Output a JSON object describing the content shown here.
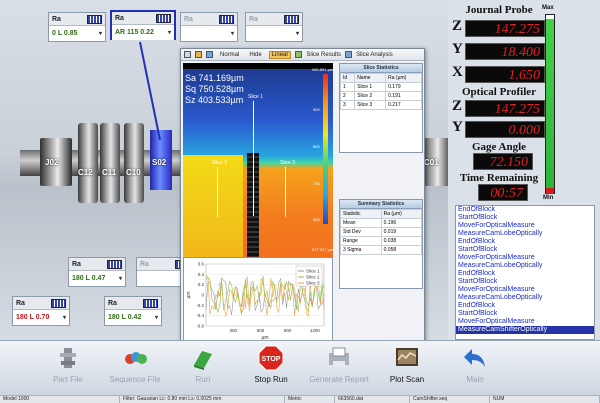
{
  "background_part": {
    "labels": [
      "J02",
      "C12",
      "C11",
      "C10",
      "S02",
      "C01"
    ]
  },
  "ra_widgets": [
    {
      "title": "Ra",
      "value": "0 L  0.85",
      "state": "active"
    },
    {
      "title": "Ra",
      "value": "AR  115  0.22",
      "state": "selected"
    },
    {
      "title": "Ra",
      "value": "",
      "state": "dim"
    },
    {
      "title": "Ra",
      "value": "",
      "state": "dim"
    },
    {
      "title": "Ra",
      "value": "180 L  0.47",
      "state": "active"
    },
    {
      "title": "Ra",
      "value": "",
      "state": "dim"
    },
    {
      "title": "Ra",
      "value": "180 L  0.70",
      "state": "active-red"
    },
    {
      "title": "Ra",
      "value": "180 L  0.42",
      "state": "active"
    },
    {
      "title": "Ra",
      "value": "",
      "state": "dim"
    }
  ],
  "popup": {
    "toolbar": {
      "normal": "Normal",
      "hide": "Hide",
      "linear": "Linear",
      "slice_results": "Slice Results",
      "slice_analysis": "Slice Analysis"
    },
    "surface": {
      "sa": "Sa 741.169µm",
      "sq": "Sq 750.528µm",
      "sz": "Sz 403.533µm",
      "cb_max": "980.851 µm",
      "cb_min": "577.317 µm",
      "cb_ticks": [
        "900",
        "800",
        "700",
        "600"
      ],
      "slices": [
        "Slice 1",
        "Slice 2",
        "Slice 3"
      ]
    },
    "slice_stats": {
      "title": "Slice Statistics",
      "headers": [
        "Id",
        "Name",
        "Ra (µm)"
      ],
      "rows": [
        [
          "1",
          "Slice 1",
          "0.179"
        ],
        [
          "2",
          "Slice 2",
          "0.191"
        ],
        [
          "3",
          "Slice 3",
          "0.217"
        ]
      ]
    },
    "summary_stats": {
      "title": "Summary Statistics",
      "headers": [
        "Statistic",
        "Ra (µm)"
      ],
      "rows": [
        [
          "Mean",
          "0.196"
        ],
        [
          "Std Dev",
          "0.019"
        ],
        [
          "Range",
          "0.038"
        ],
        [
          "3 Sigma",
          "0.058"
        ]
      ]
    }
  },
  "chart_data": {
    "type": "line",
    "xlabel": "µm",
    "ylabel": "µm",
    "x_ticks": [
      "300",
      "600",
      "900",
      "1200"
    ],
    "y_ticks": [
      "0.6",
      "0.4",
      "0.2",
      "0",
      "-0.2",
      "-0.4",
      "-0.6"
    ],
    "xlim": [
      0,
      1300
    ],
    "ylim": [
      -0.6,
      0.6
    ],
    "legend": "top-right",
    "series": [
      {
        "name": "Slice 1",
        "color": "#9a9a9a"
      },
      {
        "name": "Slice 2",
        "color": "#8cc63f"
      },
      {
        "name": "Slice 3",
        "color": "#f0a63c"
      }
    ]
  },
  "right_panel": {
    "journal_probe": "Journal Probe",
    "max_label": "Max",
    "min_label": "Min",
    "z1": "Z",
    "z1_val": "147.275",
    "y1": "Y",
    "y1_val": "18.400",
    "x1": "X",
    "x1_val": "1.650",
    "optical_profiler": "Optical Profiler",
    "z2": "Z",
    "z2_val": "147.275",
    "y2": "Y",
    "y2_val": "0.000",
    "gage_angle": "Gage Angle",
    "gage_val": "72.150",
    "time_remaining": "Time Remaining",
    "time_val": "00:57",
    "gauge_level": 0.97,
    "colors": {
      "lcd_text": "#e52020",
      "gauge": "#3fc544"
    }
  },
  "log": [
    "EndOfBlock",
    "StartOfBlock",
    "MoveForOpticalMeasure",
    "MeasureCamLobeOptically",
    "EndOfBlock",
    "StartOfBlock",
    "MoveForOpticalMeasure",
    "MeasureCamLobeOptically",
    "EndOfBlock",
    "StartOfBlock",
    "MoveForOpticalMeasure",
    "MeasureCamLobeOptically",
    "EndOfBlock",
    "StartOfBlock",
    "MoveForOpticalMeasure",
    "MeasureCamShifterOptically"
  ],
  "toolbar": [
    {
      "label": "Part File",
      "icon": "part-file-icon",
      "enabled": false
    },
    {
      "label": "Sequence File",
      "icon": "sequence-file-icon",
      "enabled": false
    },
    {
      "label": "Run",
      "icon": "run-icon",
      "enabled": false
    },
    {
      "label": "Stop Run",
      "icon": "stop-icon",
      "enabled": true
    },
    {
      "label": "Generate Report",
      "icon": "report-icon",
      "enabled": false
    },
    {
      "label": "Plot Scan",
      "icon": "plot-scan-icon",
      "enabled": true
    },
    {
      "label": "Main",
      "icon": "back-arrow-icon",
      "enabled": false
    }
  ],
  "status_bar": [
    "Model 1000",
    "Filter: Gaussian Lc: 0.80 mm Ls: 0.0025 mm",
    "Metric",
    "663560.dat",
    "CamShifter.seq",
    "NUM"
  ]
}
